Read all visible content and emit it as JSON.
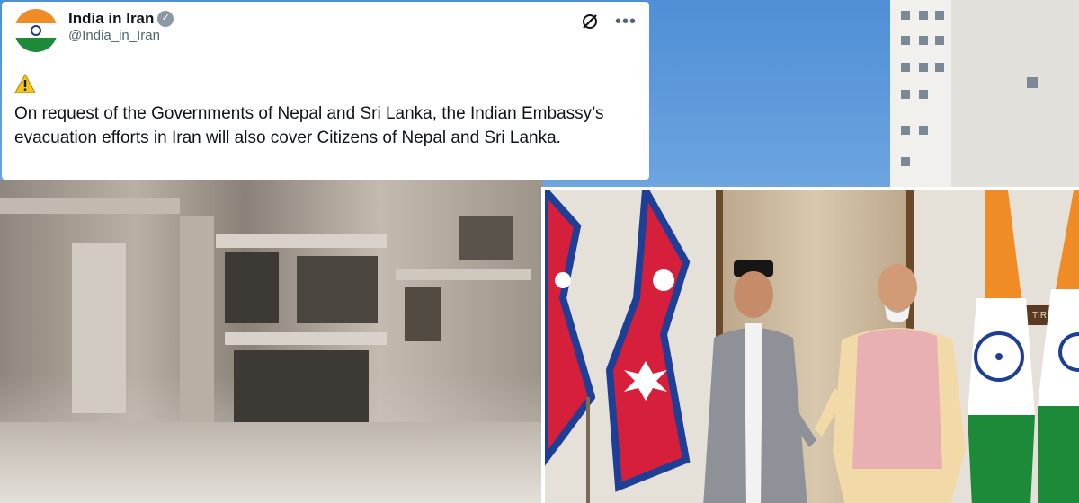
{
  "tweet": {
    "display_name": "India in Iran",
    "handle": "@India_in_Iran",
    "verified": true,
    "warning_emoji": "⚠️",
    "text": "On request of the Governments of Nepal and Sri Lanka, the Indian Embassy’s evacuation efforts in Iran will also cover Citizens of Nepal and Sri Lanka."
  },
  "photo": {
    "nameplate_text": "TIR"
  },
  "colors": {
    "saffron": "#f08c25",
    "india_green": "#1d8a3a",
    "nepal_red": "#d61f3a",
    "nepal_blue": "#1e3f96"
  }
}
